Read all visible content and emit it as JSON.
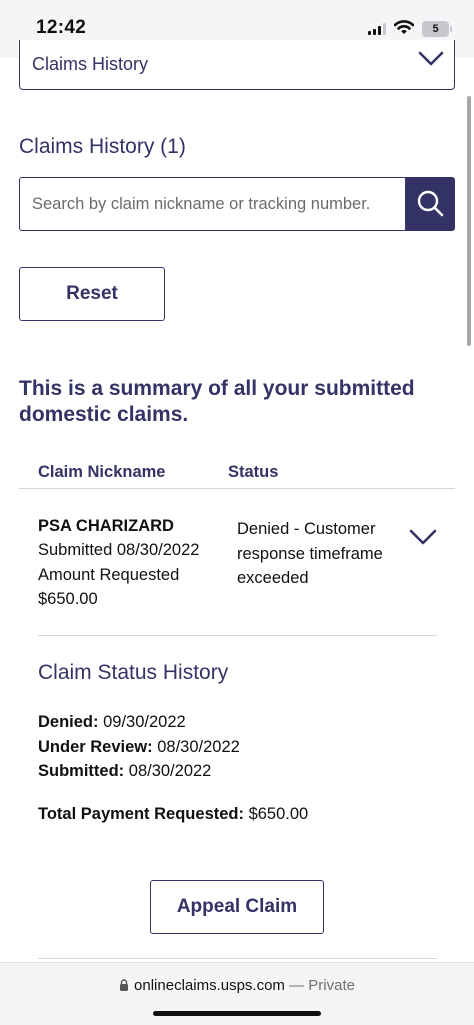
{
  "status_bar": {
    "time": "12:42",
    "battery": "5"
  },
  "dropdown": {
    "selected": "Claims History"
  },
  "section_title": "Claims History (1)",
  "search": {
    "placeholder": "Search by claim nickname or tracking number."
  },
  "reset_label": "Reset",
  "summary_heading": "This is a summary of all your submitted domestic claims.",
  "table": {
    "columns": [
      "Claim Nickname",
      "Status"
    ],
    "rows": [
      {
        "nickname": "PSA CHARIZARD",
        "submitted": "Submitted 08/30/2022",
        "amount_label": "Amount Requested",
        "amount": "$650.00",
        "status": "Denied - Customer response timeframe exceeded"
      }
    ]
  },
  "status_history": {
    "title": "Claim Status History",
    "entries": [
      {
        "label": "Denied:",
        "date": "09/30/2022"
      },
      {
        "label": "Under Review:",
        "date": "08/30/2022"
      },
      {
        "label": "Submitted:",
        "date": "08/30/2022"
      }
    ],
    "total_label": "Total Payment Requested:",
    "total_value": "$650.00"
  },
  "appeal_label": "Appeal Claim",
  "browser": {
    "url": "onlineclaims.usps.com",
    "separator": " — ",
    "mode": "Private"
  },
  "colors": {
    "brand_navy": "#333366",
    "divider": "#d6d6d6"
  },
  "icons": [
    "signal-icon",
    "wifi-icon",
    "battery-icon",
    "chevron-down-icon",
    "search-icon",
    "lock-icon"
  ]
}
